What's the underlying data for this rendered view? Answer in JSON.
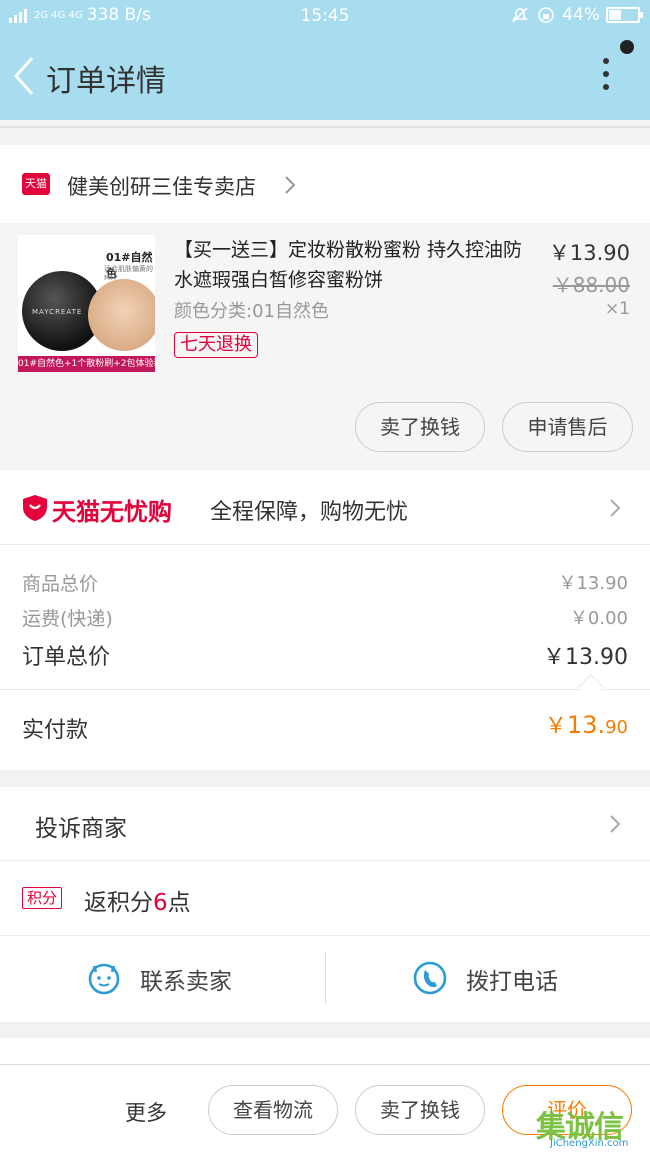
{
  "status_bar": {
    "network": "2G 4G 4G",
    "speed": "338 B/s",
    "time": "15:45",
    "battery": "44%"
  },
  "header": {
    "title": "订单详情"
  },
  "shop": {
    "badge": "天猫",
    "name": "健美创研三佳专卖店"
  },
  "product": {
    "image": {
      "brand_label": "01#自然色",
      "sub_label": "适合肌肤偏黄的MM",
      "case_label": "MAYCREATE",
      "caption": "01#自然色+1个散粉刷+2包体验装"
    },
    "title": "【买一送三】定妆粉散粉蜜粉 持久控油防水遮瑕强白皙修容蜜粉饼",
    "variant": "颜色分类:01自然色",
    "tag": "七天退换",
    "price": "￥13.90",
    "original_price": "￥88.00",
    "quantity": "×1",
    "actions": {
      "sell": "卖了换钱",
      "after_sale": "申请售后"
    }
  },
  "guarantee": {
    "brand": "天猫无忧购",
    "description": "全程保障，购物无忧"
  },
  "costs": {
    "goods_label": "商品总价",
    "goods_value": "￥13.90",
    "shipping_label": "运费(快递)",
    "shipping_value": "￥0.00",
    "total_label": "订单总价",
    "total_value": "￥13.90"
  },
  "paid": {
    "label": "实付款",
    "symbol": "￥",
    "integer": "13.",
    "decimal": "90"
  },
  "complaint": {
    "label": "投诉商家"
  },
  "points": {
    "badge": "积分",
    "prefix": "返积分",
    "amount": "6",
    "suffix": "点"
  },
  "contact": {
    "seller": "联系卖家",
    "phone": "拨打电话"
  },
  "bottom_bar": {
    "more": "更多",
    "logistics": "查看物流",
    "sell": "卖了换钱",
    "review": "评价"
  },
  "watermark": {
    "main": "集诚信",
    "sub": "JiChengXin.com"
  },
  "colors": {
    "header_bg": "#a8ddf0",
    "tmall_red": "#e4003a",
    "accent_orange": "#f57c00",
    "icon_blue": "#2b9bd3"
  }
}
